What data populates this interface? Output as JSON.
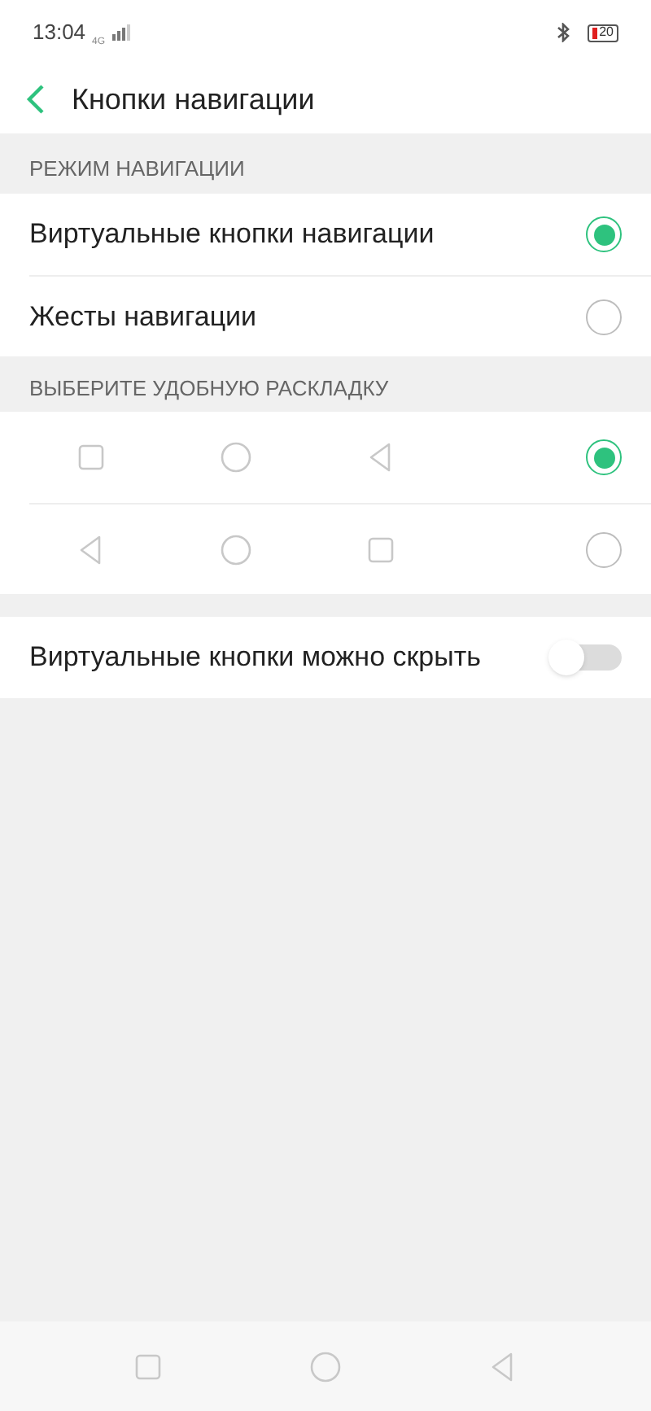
{
  "status_bar": {
    "time": "13:04",
    "network": "4G",
    "battery": "20"
  },
  "header": {
    "title": "Кнопки навигации"
  },
  "navigation_mode": {
    "heading": "РЕЖИМ НАВИГАЦИИ",
    "options": [
      {
        "label": "Виртуальные кнопки навигации",
        "selected": true
      },
      {
        "label": "Жесты навигации",
        "selected": false
      }
    ]
  },
  "layout": {
    "heading": "ВЫБЕРИТЕ УДОБНУЮ РАСКЛАДКУ",
    "options": [
      {
        "keys": [
          {
            "kind": "square"
          },
          {
            "kind": "circle"
          },
          {
            "kind": "triangle"
          }
        ],
        "selected": true
      },
      {
        "keys": [
          {
            "kind": "triangle"
          },
          {
            "kind": "circle"
          },
          {
            "kind": "square"
          }
        ],
        "selected": false
      }
    ]
  },
  "hide_buttons": {
    "label": "Виртуальные кнопки можно скрыть",
    "on": false
  },
  "nav_bar": {
    "keys": [
      {
        "kind": "square"
      },
      {
        "kind": "circle"
      },
      {
        "kind": "triangle"
      }
    ]
  }
}
